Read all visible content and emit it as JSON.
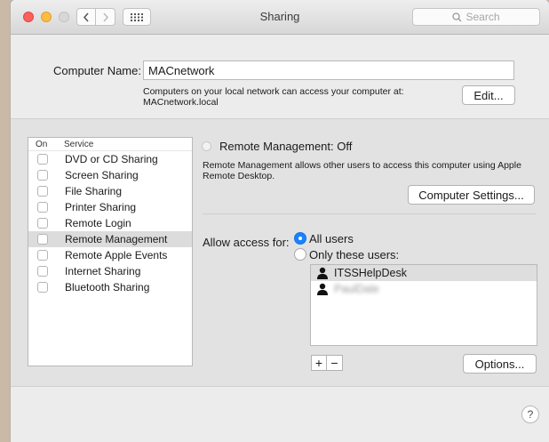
{
  "window": {
    "title": "Sharing",
    "search_placeholder": "Search",
    "colors": {
      "close": "#fc605c",
      "minimize": "#fdbc40",
      "zoom": "#d8d8d8",
      "accent": "#1a82fb"
    }
  },
  "computer_name": {
    "label": "Computer Name:",
    "value": "MACnetwork",
    "info": "Computers on your local network can access your computer at: MACnetwork.local",
    "edit_label": "Edit..."
  },
  "services": {
    "header_on": "On",
    "header_service": "Service",
    "items": [
      {
        "name": "DVD or CD Sharing",
        "on": false
      },
      {
        "name": "Screen Sharing",
        "on": false
      },
      {
        "name": "File Sharing",
        "on": false
      },
      {
        "name": "Printer Sharing",
        "on": false
      },
      {
        "name": "Remote Login",
        "on": false
      },
      {
        "name": "Remote Management",
        "on": false,
        "selected": true
      },
      {
        "name": "Remote Apple Events",
        "on": false
      },
      {
        "name": "Internet Sharing",
        "on": false
      },
      {
        "name": "Bluetooth Sharing",
        "on": false
      }
    ]
  },
  "detail": {
    "status": "Remote Management: Off",
    "description": "Remote Management allows other users to access this computer using Apple Remote Desktop.",
    "computer_settings_label": "Computer Settings...",
    "allow_label": "Allow access for:",
    "option_all": "All users",
    "option_only": "Only these users:",
    "users": [
      "ITSSHelpDesk",
      "PaulDale"
    ],
    "plus": "+",
    "minus": "−",
    "options_label": "Options..."
  },
  "help": "?"
}
